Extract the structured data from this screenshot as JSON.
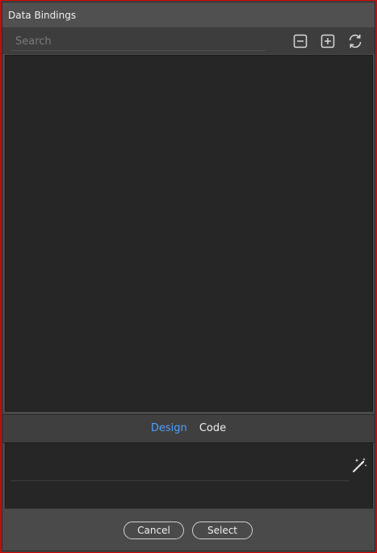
{
  "window": {
    "title": "Data Bindings"
  },
  "toolbar": {
    "search_placeholder": "Search",
    "collapse_icon": "collapse-all-icon",
    "expand_icon": "expand-all-icon",
    "refresh_icon": "refresh-icon"
  },
  "tabs": [
    {
      "label": "Design",
      "active": true
    },
    {
      "label": "Code",
      "active": false
    }
  ],
  "editor": {
    "wand_icon": "magic-wand-icon"
  },
  "footer": {
    "cancel_label": "Cancel",
    "select_label": "Select"
  },
  "colors": {
    "accent": "#4fa0ff",
    "border": "#d40000",
    "panel": "#262626"
  }
}
